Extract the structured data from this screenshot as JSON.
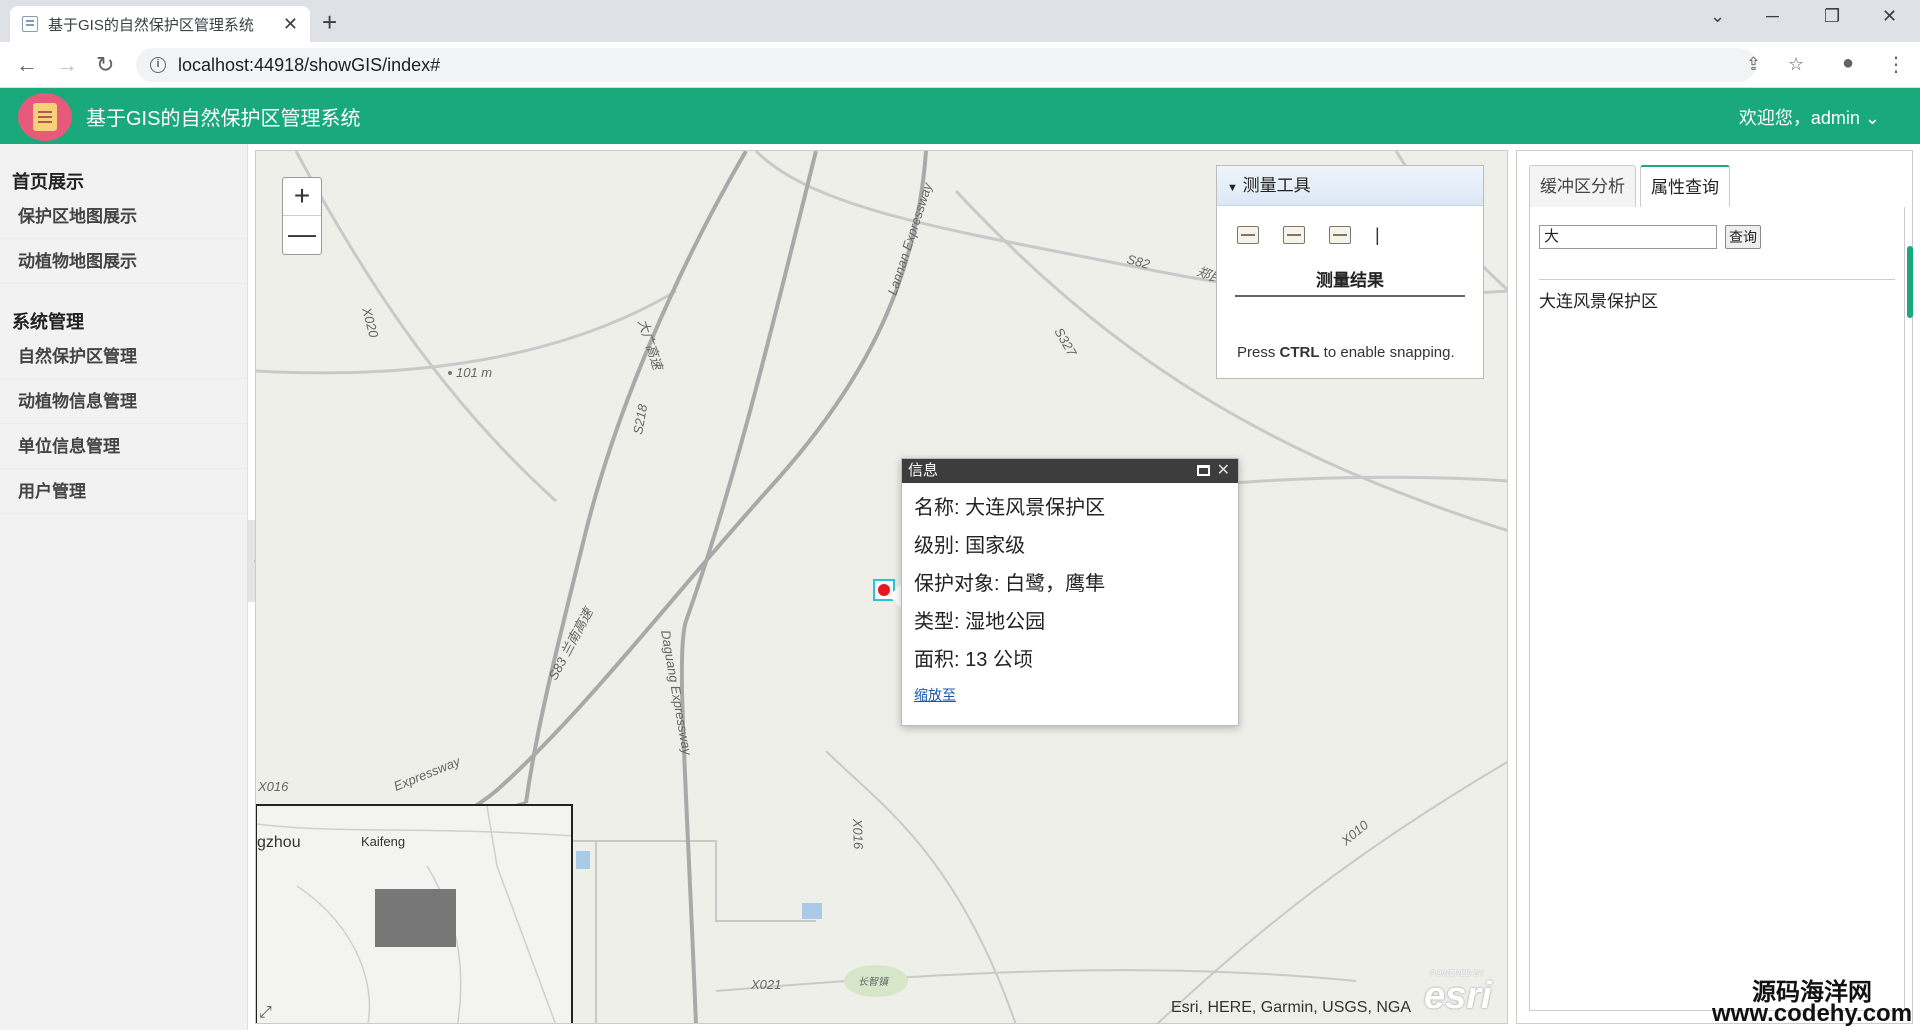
{
  "browser": {
    "tab_title": "基于GIS的自然保护区管理系统",
    "tab_close": "✕",
    "new_tab": "+",
    "url": "localhost:44918/showGIS/index#"
  },
  "header": {
    "title": "基于GIS的自然保护区管理系统",
    "welcome": "欢迎您，admin"
  },
  "sidebar": {
    "groups": [
      {
        "label": "首页展示",
        "items": [
          "保护区地图展示",
          "动植物地图展示"
        ]
      },
      {
        "label": "系统管理",
        "items": [
          "自然保护区管理",
          "动植物信息管理",
          "单位信息管理",
          "用户管理"
        ]
      }
    ]
  },
  "map": {
    "zoom_in": "+",
    "zoom_out": "—",
    "measure": {
      "title": "测量工具",
      "result_label": "测量结果",
      "snap_prefix": "Press ",
      "snap_key": "CTRL",
      "snap_suffix": " to enable snapping."
    },
    "popup": {
      "title": "信息",
      "close": "✕",
      "rows": [
        "名称: 大连风景保护区",
        "级别: 国家级",
        "保护对象: 白鹭，鹰隼",
        "类型: 湿地公园",
        "面积: 13 公顷"
      ],
      "link": "缩放至"
    },
    "labels": {
      "s82": "S82",
      "zhengmin": "郑民高速",
      "s327": "S327",
      "lannan": "Lannan Expressway",
      "daguang_cn": "大广高速",
      "s218": "S218",
      "x020": "X020",
      "elev": "101 m",
      "lanan": "S83 兰南高速",
      "daguang": "Daguang Expressway",
      "expressway": "Expressway",
      "x016a": "X016",
      "x016b": "X016",
      "x010": "X010",
      "x021": "X021",
      "town": "长智镇"
    },
    "overview": {
      "label_left": "gzhou",
      "label_kaifeng": "Kaifeng"
    },
    "attribution": "Esri, HERE, Garmin, USGS, NGA",
    "esri_powered": "POWERED BY",
    "esri_logo": "esri"
  },
  "right_panel": {
    "tabs": [
      "缓冲区分析",
      "属性查询"
    ],
    "search_value": "大",
    "search_button": "查询",
    "results": [
      "大连风景保护区"
    ]
  },
  "watermark": {
    "line1": "源码海洋网",
    "line2": "www.codehy.com"
  }
}
